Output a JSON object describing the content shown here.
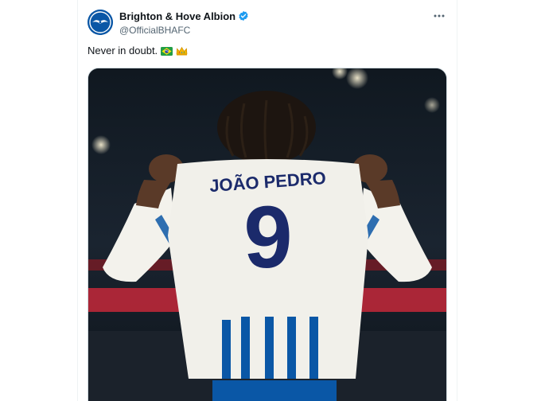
{
  "tweet": {
    "author": {
      "display_name": "Brighton & Hove Albion",
      "handle": "@OfficialBHAFC",
      "verified": true,
      "avatar_icon": "brighton-seagull-crest-icon"
    },
    "text": "Never in doubt.",
    "emojis": [
      "brazil-flag-emoji",
      "crown-emoji"
    ],
    "more_icon": "more-horizontal-icon",
    "photo": {
      "shirt_name": "JOÃO PEDRO",
      "shirt_number": "9"
    }
  },
  "colors": {
    "brand_blue": "#0057b8",
    "verified_blue": "#1d9bf0",
    "text_primary": "#0f1419",
    "text_secondary": "#536471"
  }
}
